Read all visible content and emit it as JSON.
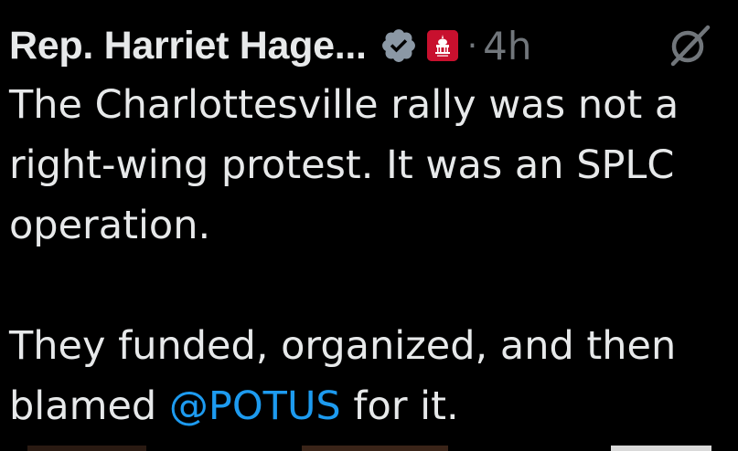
{
  "author": {
    "name": "Rep. Harriet Hage...",
    "verified_icon": "verified-badge-icon",
    "affiliate_icon": "capitol-affiliate-icon"
  },
  "meta": {
    "separator": "·",
    "timestamp": "4h",
    "grok_icon": "grok-icon"
  },
  "body": {
    "line1": "The Charlottesville rally was not a",
    "line2": "right-wing protest. It was an SPLC",
    "line3": "operation.",
    "line4": "They funded, organized, and then",
    "line5_prefix": "blamed ",
    "mention": "@POTUS",
    "line5_suffix": " for it."
  },
  "colors": {
    "background": "#000000",
    "text": "#e7e9ea",
    "muted": "#71767b",
    "link": "#1d9bf0",
    "verified": "#8b98a5",
    "affiliate": "#c8102e"
  }
}
